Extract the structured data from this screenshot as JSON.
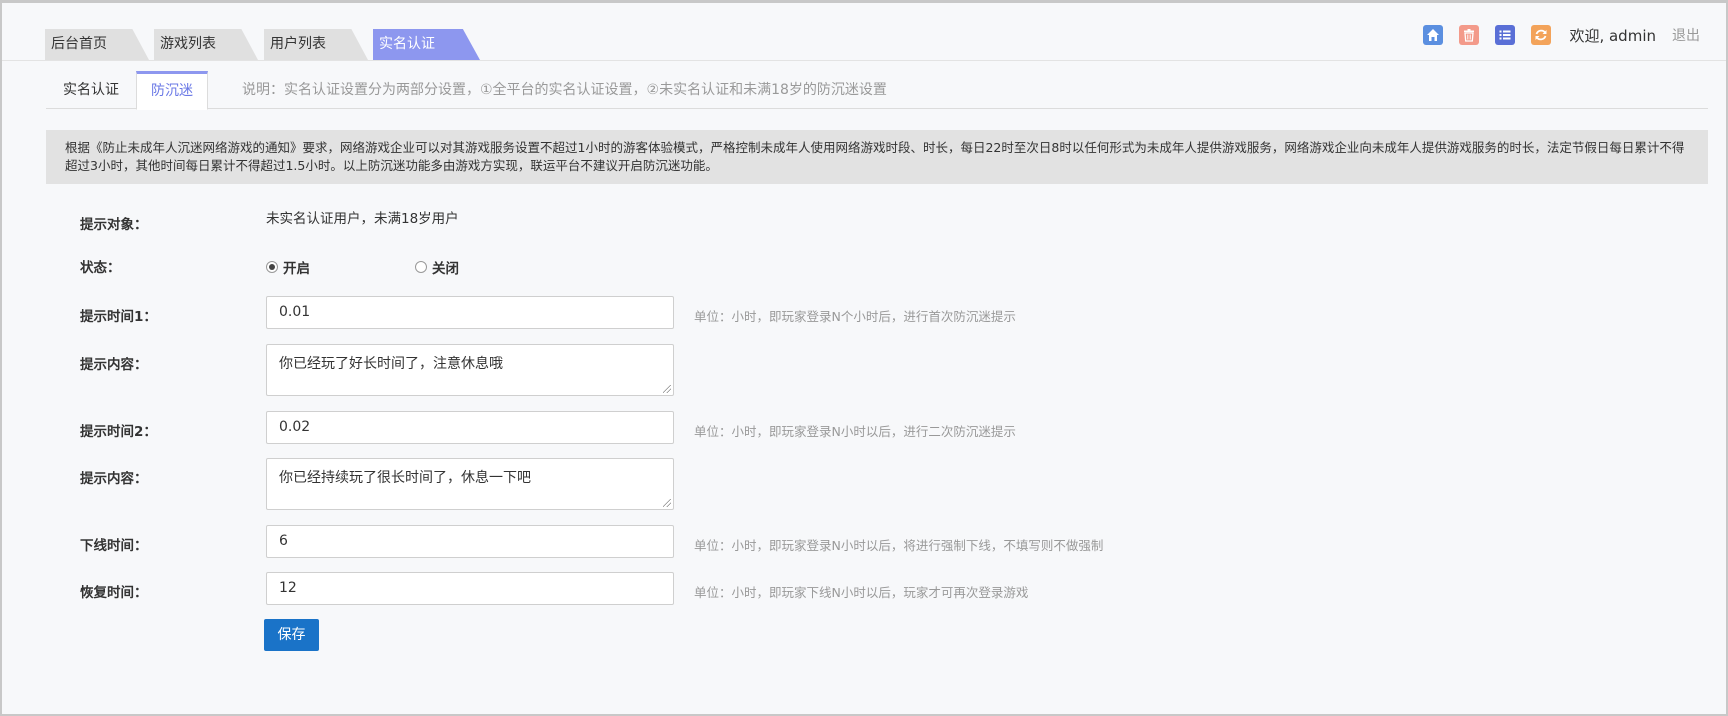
{
  "header": {
    "tabs": [
      "后台首页",
      "游戏列表",
      "用户列表",
      "实名认证"
    ],
    "active_tab_index": 3,
    "welcome": "欢迎, admin",
    "logout": "退出",
    "icons": [
      "home-icon",
      "trash-icon",
      "list-icon",
      "refresh-icon"
    ],
    "icon_colors": [
      "#5b8fe0",
      "#f39a8a",
      "#5a6fd6",
      "#f3a35a"
    ]
  },
  "subtabs": {
    "items": [
      "实名认证",
      "防沉迷"
    ],
    "active_index": 1,
    "note": "说明：实名认证设置分为两部分设置，①全平台的实名认证设置，②未实名认证和未满18岁的防沉迷设置"
  },
  "notice": "根据《防止未成年人沉迷网络游戏的通知》要求，网络游戏企业可以对其游戏服务设置不超过1小时的游客体验模式，严格控制未成年人使用网络游戏时段、时长，每日22时至次日8时以任何形式为未成年人提供游戏服务，网络游戏企业向未成年人提供游戏服务的时长，法定节假日每日累计不得超过3小时，其他时间每日累计不得超过1.5小时。以上防沉迷功能多由游戏方实现，联运平台不建议开启防沉迷功能。",
  "form": {
    "target_label": "提示对象：",
    "target_value": "未实名认证用户，未满18岁用户",
    "status_label": "状态：",
    "status_on": "开启",
    "status_off": "关闭",
    "status_selected": "开启",
    "time1_label": "提示时间1：",
    "time1_value": "0.01",
    "time1_hint": "单位：小时，即玩家登录N个小时后，进行首次防沉迷提示",
    "content1_label": "提示内容：",
    "content1_value": "你已经玩了好长时间了，注意休息哦",
    "time2_label": "提示时间2：",
    "time2_value": "0.02",
    "time2_hint": "单位：小时，即玩家登录N小时以后，进行二次防沉迷提示",
    "content2_label": "提示内容：",
    "content2_value": "你已经持续玩了很长时间了，休息一下吧",
    "offline_label": "下线时间：",
    "offline_value": "6",
    "offline_hint": "单位：小时，即玩家登录N小时以后，将进行强制下线，不填写则不做强制",
    "recover_label": "恢复时间：",
    "recover_value": "12",
    "recover_hint": "单位：小时，即玩家下线N小时以后，玩家才可再次登录游戏",
    "save_label": "保存"
  },
  "colors": {
    "accent": "#8d97ef",
    "save_button": "#1a73c8",
    "notice_bg": "#e2e2e2"
  }
}
